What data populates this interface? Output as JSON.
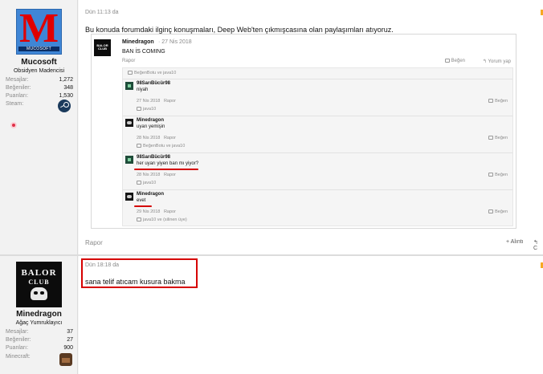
{
  "posts": [
    {
      "date": "Dün 11:13 da",
      "text": "Bu konuda forumdaki ilginç konuşmaları, Deep Web'ten çıkmışcasına olan paylaşımları atıyoruz.",
      "user": {
        "avatar_text": "M",
        "avatar_sub": "MUCOSOFT",
        "name": "Mucosoft",
        "title": "Obsidyen Madencisi",
        "stats": [
          {
            "key": "Mesajlar:",
            "value": "1,272"
          },
          {
            "key": "Beğeniler:",
            "value": "348"
          },
          {
            "key": "Puanları:",
            "value": "1,530"
          },
          {
            "key": "Steam:",
            "value": ""
          }
        ]
      },
      "quote": {
        "avatar_text": "BALOR CLUB",
        "author": "Minedragon",
        "date": "· 27 Nis 2018",
        "text": "BAN İS COMING",
        "report": "Rapor",
        "like": "Beğen",
        "reply": "Yorum yap",
        "likers": "BeğenBotu ve java10",
        "comments": [
          {
            "author": "98SarıBücür98",
            "text": "niyah",
            "date": "27 Nis 2018",
            "report": "Rapor",
            "like": "Beğen",
            "likers": "java10",
            "avatar": "green"
          },
          {
            "author": "Minedragon",
            "text": "uyarı yemişin",
            "date": "28 Nis 2018",
            "report": "Rapor",
            "like": "Beğen",
            "likers": "BeğenBotu ve java10",
            "avatar": "dark"
          },
          {
            "author": "98SarıBücür98",
            "text": "her uyarı yiyen ban mı yiyor?",
            "date": "28 Nis 2018",
            "report": "Rapor",
            "like": "Beğen",
            "likers": "java10",
            "avatar": "green"
          },
          {
            "author": "Minedragon",
            "text": "evet",
            "date": "29 Nis 2018",
            "report": "Rapor",
            "like": "Beğen",
            "likers": "java10 ve (silinen üye)",
            "avatar": "dark"
          }
        ]
      },
      "footer": {
        "report": "Rapor",
        "quote": "+ Alıntı",
        "reply": "↰ C"
      }
    },
    {
      "date": "Dün 18:18 da",
      "text": "sana telif atıcam kusura bakma",
      "user": {
        "avatar_text1": "BALOR",
        "avatar_text2": "CLUB",
        "name": "Minedragon",
        "title": "Ağaç Yumruklayıcı",
        "stats": [
          {
            "key": "Mesajlar:",
            "value": "37"
          },
          {
            "key": "Beğeniler:",
            "value": "27"
          },
          {
            "key": "Puanları:",
            "value": "900"
          },
          {
            "key": "Minecraft:",
            "value": ""
          }
        ]
      }
    }
  ]
}
